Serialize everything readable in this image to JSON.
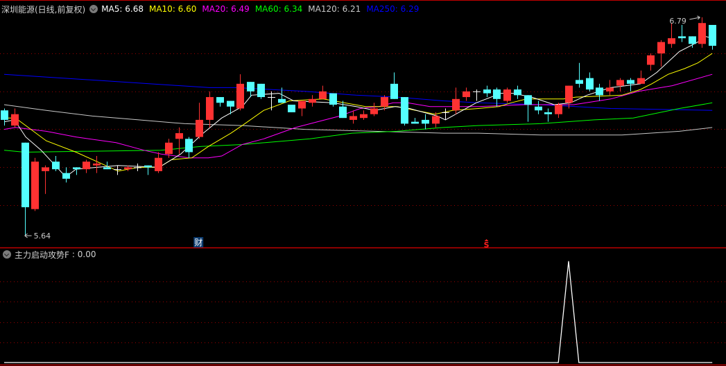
{
  "chart_data": {
    "type": "candlestick",
    "title": "深圳能源(日线,前复权)",
    "colors": {
      "up": "#ff3232",
      "down": "#54ffff",
      "grid": "#9a0000",
      "border": "#c00000"
    },
    "ma_legend": [
      {
        "label": "MA5:",
        "value": "6.68",
        "color": "#ffffff"
      },
      {
        "label": "MA10:",
        "value": "6.60",
        "color": "#ffff00"
      },
      {
        "label": "MA20:",
        "value": "6.49",
        "color": "#ff00ff"
      },
      {
        "label": "MA60:",
        "value": "6.34",
        "color": "#00ff00"
      },
      {
        "label": "MA120:",
        "value": "6.21",
        "color": "#c8c8c8"
      },
      {
        "label": "MA250:",
        "value": "6.29",
        "color": "#0000ff"
      }
    ],
    "candles_ohlc": [
      [
        6.3,
        6.31,
        6.22,
        6.25
      ],
      [
        6.22,
        6.31,
        6.21,
        6.28
      ],
      [
        6.13,
        6.13,
        5.64,
        5.79
      ],
      [
        5.78,
        6.05,
        5.77,
        6.03
      ],
      [
        5.98,
        6.01,
        5.86,
        6.0
      ],
      [
        6.03,
        6.06,
        5.98,
        5.99
      ],
      [
        5.97,
        6.0,
        5.92,
        5.94
      ],
      [
        6.0,
        6.0,
        5.96,
        5.99
      ],
      [
        5.99,
        6.04,
        5.97,
        6.03
      ],
      [
        6.01,
        6.06,
        5.97,
        6.02
      ],
      [
        6.0,
        6.03,
        5.99,
        5.99
      ],
      [
        5.99,
        6.01,
        5.96,
        5.99
      ],
      [
        5.99,
        6.01,
        5.98,
        6.0
      ],
      [
        6.0,
        6.02,
        5.98,
        6.0
      ],
      [
        6.01,
        6.01,
        5.96,
        6.0
      ],
      [
        5.98,
        6.08,
        5.97,
        6.05
      ],
      [
        6.07,
        6.15,
        6.05,
        6.13
      ],
      [
        6.15,
        6.21,
        6.07,
        6.18
      ],
      [
        6.15,
        6.16,
        6.05,
        6.08
      ],
      [
        6.16,
        6.34,
        6.15,
        6.25
      ],
      [
        6.25,
        6.4,
        6.21,
        6.37
      ],
      [
        6.37,
        6.37,
        6.32,
        6.34
      ],
      [
        6.35,
        6.35,
        6.28,
        6.32
      ],
      [
        6.31,
        6.49,
        6.3,
        6.44
      ],
      [
        6.45,
        6.45,
        6.37,
        6.4
      ],
      [
        6.44,
        6.44,
        6.36,
        6.37
      ],
      [
        6.37,
        6.4,
        6.3,
        6.37
      ],
      [
        6.36,
        6.42,
        6.34,
        6.34
      ],
      [
        6.33,
        6.33,
        6.29,
        6.29
      ],
      [
        6.31,
        6.35,
        6.27,
        6.35
      ],
      [
        6.34,
        6.38,
        6.32,
        6.36
      ],
      [
        6.36,
        6.43,
        6.36,
        6.4
      ],
      [
        6.39,
        6.39,
        6.32,
        6.33
      ],
      [
        6.32,
        6.35,
        6.26,
        6.26
      ],
      [
        6.25,
        6.3,
        6.23,
        6.27
      ],
      [
        6.26,
        6.3,
        6.25,
        6.28
      ],
      [
        6.28,
        6.34,
        6.27,
        6.31
      ],
      [
        6.32,
        6.38,
        6.3,
        6.37
      ],
      [
        6.44,
        6.5,
        6.36,
        6.36
      ],
      [
        6.37,
        6.37,
        6.22,
        6.23
      ],
      [
        6.24,
        6.26,
        6.23,
        6.23
      ],
      [
        6.25,
        6.28,
        6.2,
        6.23
      ],
      [
        6.23,
        6.29,
        6.21,
        6.27
      ],
      [
        6.29,
        6.31,
        6.25,
        6.29
      ],
      [
        6.3,
        6.42,
        6.28,
        6.36
      ],
      [
        6.37,
        6.42,
        6.35,
        6.4
      ],
      [
        6.4,
        6.41,
        6.35,
        6.4
      ],
      [
        6.41,
        6.43,
        6.37,
        6.39
      ],
      [
        6.41,
        6.42,
        6.32,
        6.36
      ],
      [
        6.35,
        6.42,
        6.34,
        6.41
      ],
      [
        6.41,
        6.43,
        6.36,
        6.38
      ],
      [
        6.38,
        6.38,
        6.24,
        6.33
      ],
      [
        6.32,
        6.35,
        6.28,
        6.3
      ],
      [
        6.29,
        6.31,
        6.24,
        6.28
      ],
      [
        6.28,
        6.34,
        6.26,
        6.33
      ],
      [
        6.34,
        6.43,
        6.31,
        6.43
      ],
      [
        6.46,
        6.55,
        6.42,
        6.44
      ],
      [
        6.47,
        6.5,
        6.4,
        6.41
      ],
      [
        6.42,
        6.44,
        6.35,
        6.38
      ],
      [
        6.4,
        6.46,
        6.38,
        6.42
      ],
      [
        6.43,
        6.47,
        6.4,
        6.46
      ],
      [
        6.46,
        6.47,
        6.4,
        6.44
      ],
      [
        6.44,
        6.51,
        6.44,
        6.47
      ],
      [
        6.54,
        6.6,
        6.51,
        6.59
      ],
      [
        6.6,
        6.67,
        6.53,
        6.66
      ],
      [
        6.65,
        6.76,
        6.63,
        6.68
      ],
      [
        6.69,
        6.75,
        6.66,
        6.68
      ],
      [
        6.69,
        6.69,
        6.63,
        6.65
      ],
      [
        6.65,
        6.79,
        6.63,
        6.76
      ],
      [
        6.75,
        6.75,
        6.62,
        6.64
      ]
    ],
    "ma_series": [
      {
        "name": "MA5",
        "color": "#ffffff",
        "points": [
          [
            0,
            6.24
          ],
          [
            1,
            6.25
          ],
          [
            2.1,
            6.16
          ],
          [
            3.6,
            6.09
          ],
          [
            6,
            5.95
          ],
          [
            7,
            5.99
          ],
          [
            11.1,
            6.01
          ],
          [
            15.1,
            6.0
          ],
          [
            17.2,
            6.07
          ],
          [
            19.4,
            6.18
          ],
          [
            21.2,
            6.26
          ],
          [
            23.2,
            6.32
          ],
          [
            24.1,
            6.38
          ],
          [
            26.8,
            6.39
          ],
          [
            28.2,
            6.35
          ],
          [
            32,
            6.34
          ],
          [
            34.3,
            6.32
          ],
          [
            36.1,
            6.3
          ],
          [
            38.1,
            6.32
          ],
          [
            39.5,
            6.31
          ],
          [
            42.2,
            6.27
          ],
          [
            43,
            6.25
          ],
          [
            46,
            6.34
          ],
          [
            48.4,
            6.39
          ],
          [
            49.6,
            6.39
          ],
          [
            51.4,
            6.37
          ],
          [
            53.6,
            6.33
          ],
          [
            55.2,
            6.34
          ],
          [
            56.8,
            6.38
          ],
          [
            59.1,
            6.42
          ],
          [
            62,
            6.44
          ],
          [
            63.6,
            6.5
          ],
          [
            65.8,
            6.61
          ],
          [
            67.6,
            6.66
          ],
          [
            68.3,
            6.69
          ],
          [
            69,
            6.68
          ]
        ]
      },
      {
        "name": "MA10",
        "color": "#ffff00",
        "points": [
          [
            0,
            6.26
          ],
          [
            1.1,
            6.26
          ],
          [
            2.1,
            6.22
          ],
          [
            4.1,
            6.14
          ],
          [
            7,
            6.08
          ],
          [
            11.1,
            5.98
          ],
          [
            13.1,
            6.0
          ],
          [
            15.1,
            6.0
          ],
          [
            16.3,
            6.04
          ],
          [
            18.3,
            6.05
          ],
          [
            19.9,
            6.11
          ],
          [
            22.1,
            6.18
          ],
          [
            23.2,
            6.22
          ],
          [
            25.3,
            6.3
          ],
          [
            27.8,
            6.35
          ],
          [
            31.1,
            6.36
          ],
          [
            35.2,
            6.32
          ],
          [
            38.3,
            6.32
          ],
          [
            40.1,
            6.3
          ],
          [
            42,
            6.28
          ],
          [
            43.7,
            6.3
          ],
          [
            46.2,
            6.31
          ],
          [
            48.2,
            6.32
          ],
          [
            49.4,
            6.34
          ],
          [
            50.9,
            6.36
          ],
          [
            54.5,
            6.36
          ],
          [
            55.7,
            6.37
          ],
          [
            60.2,
            6.38
          ],
          [
            62,
            6.41
          ],
          [
            63.1,
            6.44
          ],
          [
            64.7,
            6.49
          ],
          [
            66.3,
            6.52
          ],
          [
            67.6,
            6.55
          ],
          [
            69,
            6.6
          ]
        ]
      },
      {
        "name": "MA20",
        "color": "#ff00ff",
        "points": [
          [
            0,
            6.2
          ],
          [
            1.1,
            6.21
          ],
          [
            4.1,
            6.19
          ],
          [
            7,
            6.16
          ],
          [
            10.9,
            6.13
          ],
          [
            13.6,
            6.09
          ],
          [
            15.3,
            6.07
          ],
          [
            18,
            6.05
          ],
          [
            19.9,
            6.05
          ],
          [
            21.2,
            6.06
          ],
          [
            23.2,
            6.12
          ],
          [
            25.3,
            6.15
          ],
          [
            28.4,
            6.21
          ],
          [
            32.7,
            6.27
          ],
          [
            34.7,
            6.31
          ],
          [
            36.5,
            6.32
          ],
          [
            37.9,
            6.34
          ],
          [
            39.3,
            6.34
          ],
          [
            41.5,
            6.32
          ],
          [
            45.1,
            6.32
          ],
          [
            46.2,
            6.32
          ],
          [
            50.7,
            6.33
          ],
          [
            55.5,
            6.33
          ],
          [
            59.1,
            6.36
          ],
          [
            61.8,
            6.4
          ],
          [
            65.1,
            6.43
          ],
          [
            69,
            6.49
          ]
        ]
      },
      {
        "name": "MA60",
        "color": "#00ff00",
        "points": [
          [
            0,
            6.09
          ],
          [
            2,
            6.08
          ],
          [
            15.3,
            6.09
          ],
          [
            19.2,
            6.11
          ],
          [
            23.2,
            6.12
          ],
          [
            29.8,
            6.15
          ],
          [
            33.9,
            6.18
          ],
          [
            38.3,
            6.19
          ],
          [
            42.8,
            6.21
          ],
          [
            46.2,
            6.22
          ],
          [
            52.3,
            6.23
          ],
          [
            57.5,
            6.25
          ],
          [
            61.3,
            6.26
          ],
          [
            65.8,
            6.31
          ],
          [
            69,
            6.34
          ]
        ]
      },
      {
        "name": "MA120",
        "color": "#c8c8c8",
        "points": [
          [
            0,
            6.33
          ],
          [
            4.1,
            6.3
          ],
          [
            8.6,
            6.27
          ],
          [
            13.1,
            6.25
          ],
          [
            17.6,
            6.23
          ],
          [
            23.2,
            6.22
          ],
          [
            29.3,
            6.2
          ],
          [
            36.1,
            6.19
          ],
          [
            42.8,
            6.18
          ],
          [
            46.2,
            6.18
          ],
          [
            52.3,
            6.17
          ],
          [
            60.2,
            6.17
          ],
          [
            65.8,
            6.19
          ],
          [
            69,
            6.21
          ]
        ]
      },
      {
        "name": "MA250",
        "color": "#0000ff",
        "points": [
          [
            0,
            6.49
          ],
          [
            20,
            6.42
          ],
          [
            22.6,
            6.42
          ],
          [
            29.3,
            6.4
          ],
          [
            34.3,
            6.38
          ],
          [
            38.3,
            6.37
          ],
          [
            42.8,
            6.35
          ],
          [
            46.2,
            6.34
          ],
          [
            52.3,
            6.33
          ],
          [
            59.1,
            6.31
          ],
          [
            69,
            6.3
          ]
        ]
      }
    ],
    "annotations": {
      "high": {
        "label": "6.79",
        "index": 68,
        "price": 6.79
      },
      "low": {
        "label": "5.64",
        "index": 2,
        "price": 5.64
      }
    },
    "markers": [
      {
        "label": "财",
        "index": 19,
        "color": "#ffffff",
        "bg": "#0a3a6e"
      },
      {
        "label": "S",
        "index": 47,
        "color": "#ff2020"
      }
    ],
    "indicator": {
      "name": "主力启动攻势F",
      "value_text": ": 0.00",
      "ylim": [
        0,
        1
      ],
      "values": [
        0,
        0,
        0,
        0,
        0,
        0,
        0,
        0,
        0,
        0,
        0,
        0,
        0,
        0,
        0,
        0,
        0,
        0,
        0,
        0,
        0,
        0,
        0,
        0,
        0,
        0,
        0,
        0,
        0,
        0,
        0,
        0,
        0,
        0,
        0,
        0,
        0,
        0,
        0,
        0,
        0,
        0,
        0,
        0,
        0,
        0,
        0,
        0,
        0,
        0,
        0,
        0,
        0,
        0,
        0,
        1,
        0,
        0,
        0,
        0,
        0,
        0,
        0,
        0,
        0,
        0,
        0,
        0,
        0,
        0
      ]
    }
  }
}
